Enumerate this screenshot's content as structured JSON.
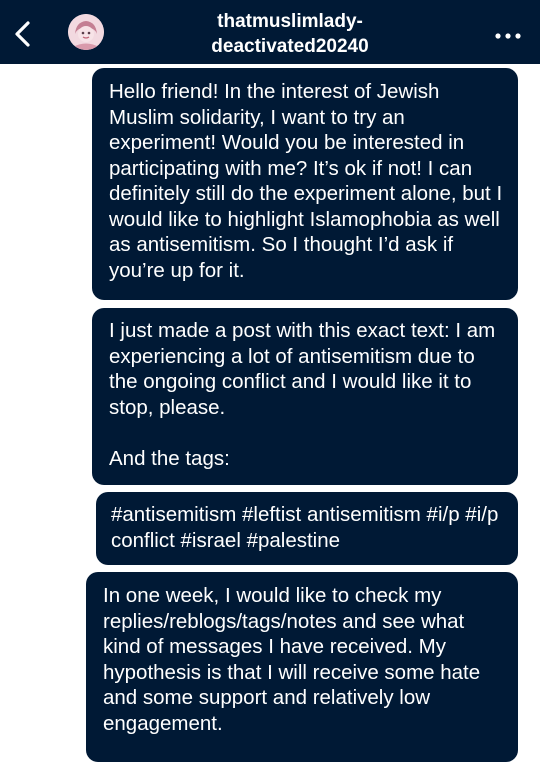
{
  "header": {
    "username": "thatmuslimlady-deactivated20240",
    "back_icon": "chevron-left-icon",
    "more_icon": "more-horizontal-icon",
    "colors": {
      "bar": "#001935",
      "text": "#ffffff"
    }
  },
  "messages": [
    {
      "text": "Hello friend! In the interest of Jewish Muslim solidarity, I want to try an experiment! Would you be interested in participating with me? It’s ok if not! I can definitely still do the experiment alone, but I would like to highlight Islamophobia as well as antisemitism. So I thought I’d ask if you’re up for it."
    },
    {
      "text": "I just made a post with this exact text: I am experiencing a lot of antisemitism due to the ongoing conflict and I would like it to stop, please.\n\nAnd the tags:"
    },
    {
      "text": "#antisemitism #leftist antisemitism #i/p #i/p conflict #israel #palestine"
    },
    {
      "text": "In one week, I would like to check my replies/reblogs/tags/notes and see what kind of messages I have received. My hypothesis is that I will receive some hate and some support and relatively low engagement."
    }
  ]
}
